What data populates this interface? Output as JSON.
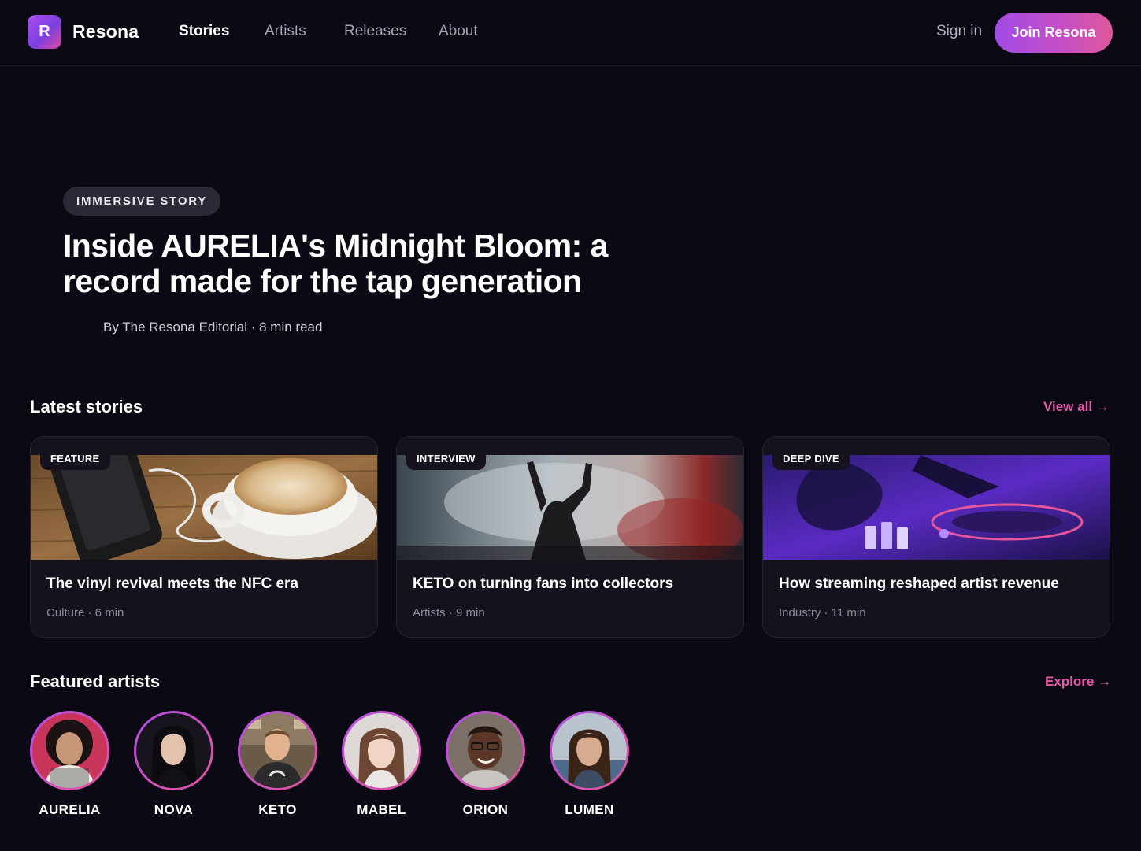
{
  "brand": {
    "logo_letter": "R",
    "name": "Resona"
  },
  "nav": {
    "links": [
      {
        "label": "Stories",
        "active": true
      },
      {
        "label": "Artists",
        "active": false
      },
      {
        "label": "Releases",
        "active": false
      },
      {
        "label": "About",
        "active": false
      }
    ],
    "sign_in": "Sign in",
    "join": "Join Resona"
  },
  "hero": {
    "tag": "IMMERSIVE STORY",
    "title": "Inside AURELIA's Midnight Bloom: a record made for the tap generation",
    "meta": "By The Resona Editorial · 8 min read"
  },
  "latest": {
    "title": "Latest stories",
    "link": "View all →",
    "cards": [
      {
        "badge": "FEATURE",
        "title": "The vinyl revival meets the NFC era",
        "meta": "Culture · 6 min",
        "image": "coffee-and-phone-photo"
      },
      {
        "badge": "INTERVIEW",
        "title": "KETO on turning fans into collectors",
        "meta": "Artists · 9 min",
        "image": "concert-crowd-photo"
      },
      {
        "badge": "DEEP DIVE",
        "title": "How streaming reshaped artist revenue",
        "meta": "Industry · 11 min",
        "image": "dj-turntable-photo"
      }
    ]
  },
  "featured": {
    "title": "Featured artists",
    "link": "Explore →",
    "artists": [
      {
        "name": "AURELIA"
      },
      {
        "name": "NOVA"
      },
      {
        "name": "KETO"
      },
      {
        "name": "MABEL"
      },
      {
        "name": "ORION"
      },
      {
        "name": "LUMEN"
      }
    ]
  },
  "colors": {
    "accent": "#e55aa8",
    "accent_purple": "#a24be6",
    "background": "#0b0913",
    "card": "#15121e"
  }
}
